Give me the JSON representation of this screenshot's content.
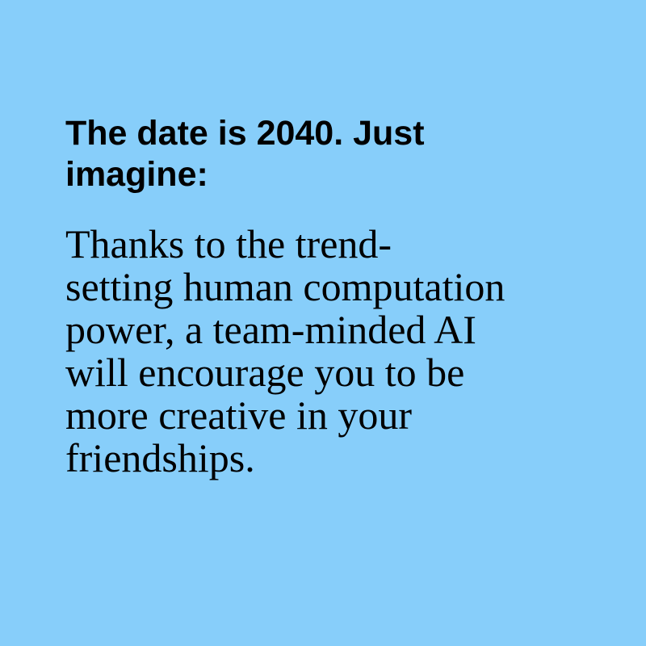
{
  "card": {
    "background_color": "#87CEFA",
    "text_color": "#000000",
    "headline_lines": [
      "The date is 2040. Just",
      "imagine:"
    ],
    "body_lines": [
      "Thanks to the trend-",
      "setting human computation",
      "power, a team-minded AI",
      "will encourage you to be",
      "more creative in your",
      "friendships."
    ]
  }
}
